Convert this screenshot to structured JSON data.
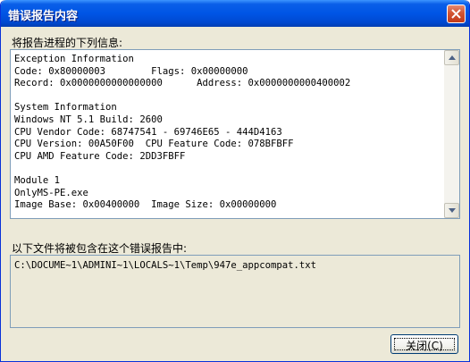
{
  "window": {
    "title": "错误报告内容"
  },
  "info_section": {
    "label": "将报告进程的下列信息:",
    "lines": [
      "Exception Information",
      "Code: 0x80000003        Flags: 0x00000000",
      "Record: 0x0000000000000000      Address: 0x0000000000400002",
      "",
      "System Information",
      "Windows NT 5.1 Build: 2600",
      "CPU Vendor Code: 68747541 - 69746E65 - 444D4163",
      "CPU Version: 00A50F00  CPU Feature Code: 078BFBFF",
      "CPU AMD Feature Code: 2DD3FBFF",
      "",
      "Module 1",
      "OnlyMS-PE.exe",
      "Image Base: 0x00400000  Image Size: 0x00000000"
    ]
  },
  "files_section": {
    "label": "以下文件将被包含在这个错误报告中:",
    "file": "C:\\DOCUME~1\\ADMINI~1\\LOCALS~1\\Temp\\947e_appcompat.txt"
  },
  "buttons": {
    "close_label": "关闭(C)"
  },
  "icons": {
    "close": "close-x-icon",
    "scroll_up": "arrow-up-icon",
    "scroll_down": "arrow-down-icon"
  }
}
